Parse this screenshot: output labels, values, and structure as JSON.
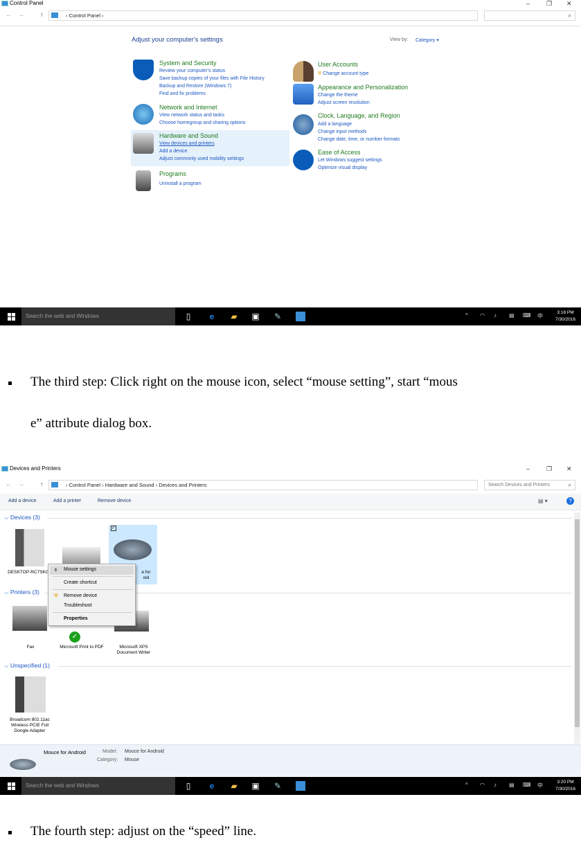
{
  "shot1": {
    "window_title": "Control Panel",
    "address": [
      "Control Panel"
    ],
    "heading": "Adjust your computer's settings",
    "view_by_label": "View by:",
    "view_by_value": "Category",
    "categories_left": [
      {
        "title": "System and Security",
        "icon": "shield-icon",
        "links": [
          "Review your computer's status",
          "Save backup copies of your files with File History",
          "Backup and Restore (Windows 7)",
          "Find and fix problems"
        ]
      },
      {
        "title": "Network and Internet",
        "icon": "network-globe-icon",
        "links": [
          "View network status and tasks",
          "Choose homegroup and sharing options"
        ]
      },
      {
        "title": "Hardware and Sound",
        "icon": "printer-speaker-icon",
        "links": [
          "View devices and printers",
          "Add a device",
          "Adjust commonly used mobility settings"
        ]
      },
      {
        "title": "Programs",
        "icon": "programs-disc-icon",
        "links": [
          "Uninstall a program"
        ]
      }
    ],
    "categories_right": [
      {
        "title": "User Accounts",
        "icon": "users-icon",
        "links": [
          "Change account type"
        ]
      },
      {
        "title": "Appearance and Personalization",
        "icon": "monitor-palette-icon",
        "links": [
          "Change the theme",
          "Adjust screen resolution"
        ]
      },
      {
        "title": "Clock, Language, and Region",
        "icon": "clock-globe-icon",
        "links": [
          "Add a language",
          "Change input methods",
          "Change date, time, or number formats"
        ]
      },
      {
        "title": "Ease of Access",
        "icon": "ease-of-access-icon",
        "links": [
          "Let Windows suggest settings",
          "Optimize visual display"
        ]
      }
    ],
    "taskbar": {
      "search": "Search the web and Windows",
      "time": "3:18 PM",
      "date": "7/30/2016",
      "ime": "中"
    }
  },
  "step3": {
    "line1": "The  third  step:  Click  right  on  the  mouse  icon,  select  “mouse  setting”,  start  “mous",
    "line2": "e”  attribute  dialog  box."
  },
  "shot2": {
    "window_title": "Devices and Printers",
    "address": [
      "Control Panel",
      "Hardware and Sound",
      "Devices and Printers"
    ],
    "search_placeholder": "Search Devices and Printers",
    "toolbar": [
      "Add a device",
      "Add a printer",
      "Remove device"
    ],
    "groups": {
      "devices": "Devices (3)",
      "printers": "Printers (3)",
      "unspecified": "Unspecified (1)"
    },
    "devices": [
      "DESKTOP-RC7SKG",
      "e for",
      "oid"
    ],
    "printers": [
      "Fax",
      "Microsoft Print to PDF",
      "Microsoft XPS Document Writer"
    ],
    "unspecified": [
      "Broadcom 802.11ac Wireless PCIE Full Dongle Adapter"
    ],
    "context_menu": [
      "Mouse settings",
      "Create shortcut",
      "Remove device",
      "Troubleshoot",
      "Properties"
    ],
    "details": {
      "name": "Mouce for Android",
      "model_label": "Model:",
      "model": "Mouce for Android",
      "category_label": "Category:",
      "category": "Mouse"
    },
    "taskbar": {
      "search": "Search the web and Windows",
      "time": "3:20 PM",
      "date": "7/30/2016",
      "ime": "中"
    }
  },
  "step4": {
    "line1": "The  fourth  step:  adjust  on  the  “speed”  line."
  }
}
